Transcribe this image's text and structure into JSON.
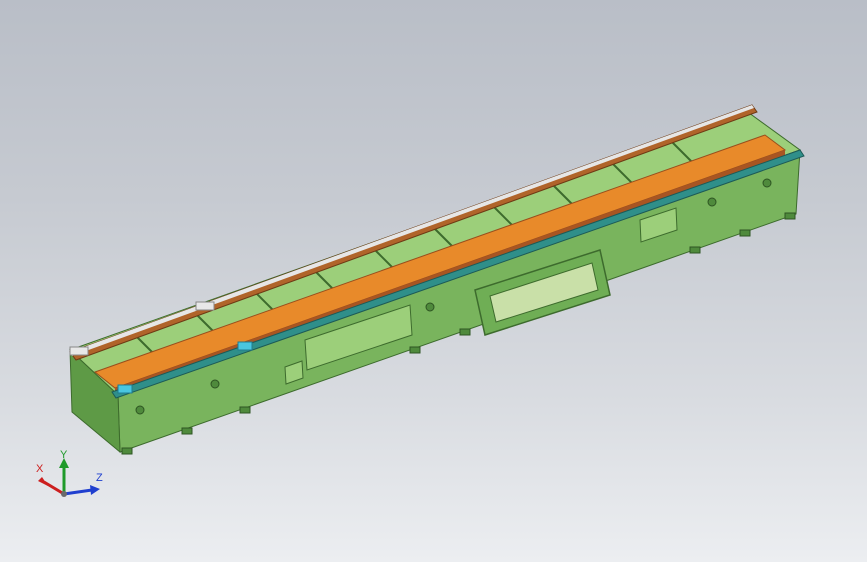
{
  "viewport": {
    "background_top": "#b9bec7",
    "background_bottom": "#eceef1"
  },
  "model": {
    "frame_color": "#79b45d",
    "frame_dark": "#4f8a3c",
    "rail_color": "#e88a2a",
    "rail_edge": "#9a4e1c",
    "slide_color": "#49c6e0"
  },
  "triad": {
    "x_label": "X",
    "y_label": "Y",
    "z_label": "Z",
    "x_color": "#cc1f1f",
    "y_color": "#1f9a2a",
    "z_color": "#1f3fcf"
  }
}
